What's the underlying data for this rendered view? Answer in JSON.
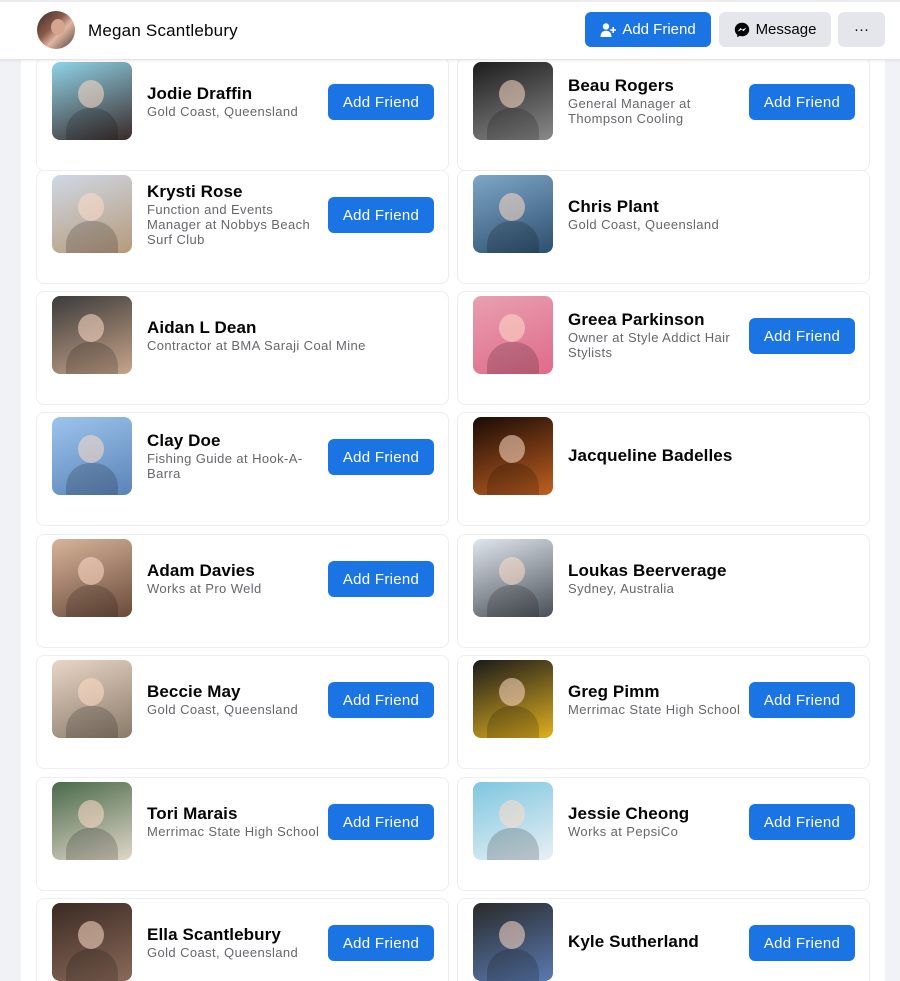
{
  "header": {
    "profile_name": "Megan Scantlebury",
    "add_friend_label": "Add Friend",
    "message_label": "Message",
    "more_label": "···",
    "accent_color": "#1b74e4"
  },
  "cards": [
    {
      "name": "Jodie Draffin",
      "sub": "Gold Coast, Queensland",
      "button": "Add Friend",
      "photo_colors": [
        "#8fd3e8",
        "#3a2a28"
      ]
    },
    {
      "name": "Beau Rogers",
      "sub": "General Manager at Thompson Cooling",
      "button": "Add Friend",
      "photo_colors": [
        "#1c1c1c",
        "#8a8a8a"
      ]
    },
    {
      "name": "Krysti Rose",
      "sub": "Function and Events Manager at Nobbys Beach Surf Club",
      "button": "Add Friend",
      "photo_colors": [
        "#cfd8e6",
        "#b69a7a"
      ]
    },
    {
      "name": "Chris Plant",
      "sub": "Gold Coast, Queensland",
      "button": "",
      "photo_colors": [
        "#7fa6c8",
        "#2d4f6e"
      ]
    },
    {
      "name": "Aidan L Dean",
      "sub": "Contractor at BMA Saraji Coal Mine",
      "button": "",
      "photo_colors": [
        "#3b3b3b",
        "#c7a48a"
      ]
    },
    {
      "name": "Greea Parkinson",
      "sub": "Owner at Style Addict Hair Stylists",
      "button": "Add Friend",
      "photo_colors": [
        "#e8a0b0",
        "#e06a8a"
      ]
    },
    {
      "name": "Clay Doe",
      "sub": "Fishing Guide at Hook-A-Barra",
      "button": "Add Friend",
      "photo_colors": [
        "#9cc4ec",
        "#5a84b8"
      ]
    },
    {
      "name": "Jacqueline Badelles",
      "sub": "",
      "button": "",
      "photo_colors": [
        "#1a0a06",
        "#c06020"
      ]
    },
    {
      "name": "Adam Davies",
      "sub": "Works at Pro Weld",
      "button": "Add Friend",
      "photo_colors": [
        "#d7b49a",
        "#6a4a3a"
      ]
    },
    {
      "name": "Loukas Beerverage",
      "sub": "Sydney, Australia",
      "button": "",
      "photo_colors": [
        "#dfe6ee",
        "#4a5058"
      ]
    },
    {
      "name": "Beccie May",
      "sub": "Gold Coast, Queensland",
      "button": "Add Friend",
      "photo_colors": [
        "#e8d6c6",
        "#8a7a6a"
      ]
    },
    {
      "name": "Greg Pimm",
      "sub": "Merrimac State High School",
      "button": "Add Friend",
      "photo_colors": [
        "#1a1a1a",
        "#e0b020"
      ]
    },
    {
      "name": "Tori Marais",
      "sub": "Merrimac State High School",
      "button": "Add Friend",
      "photo_colors": [
        "#4a6a4a",
        "#e0d6c8"
      ]
    },
    {
      "name": "Jessie Cheong",
      "sub": "Works at PepsiCo",
      "button": "Add Friend",
      "photo_colors": [
        "#7ec6e0",
        "#e8f0f4"
      ]
    },
    {
      "name": "Ella Scantlebury",
      "sub": "Gold Coast, Queensland",
      "button": "Add Friend",
      "photo_colors": [
        "#3a2a22",
        "#8a6a5a"
      ]
    },
    {
      "name": "Kyle Sutherland",
      "sub": "",
      "button": "Add Friend",
      "photo_colors": [
        "#2a2a2a",
        "#5a7ab0"
      ]
    }
  ]
}
